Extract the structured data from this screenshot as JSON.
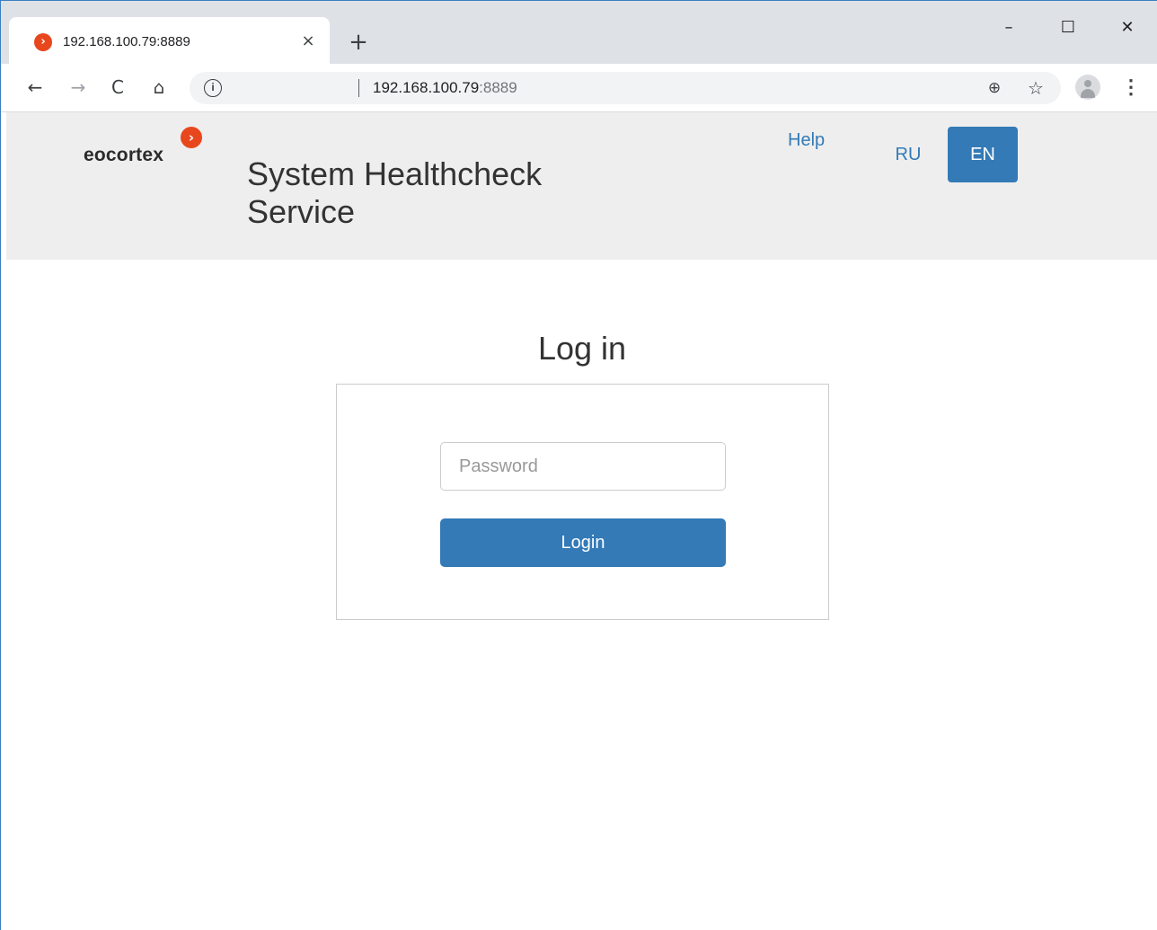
{
  "browser": {
    "tab": {
      "title": "192.168.100.79:8889",
      "favicon": "eocortex-chevron-icon"
    },
    "url": {
      "host": "192.168.100.79",
      "port": ":8889"
    },
    "icons": {
      "close": "×",
      "new_tab": "+",
      "minimize": "–",
      "maximize": "☐",
      "window_close": "✕",
      "back": "←",
      "forward": "→",
      "reload": "C",
      "home": "⌂",
      "info": "i",
      "zoom": "⊕",
      "star": "☆",
      "menu": "⋮"
    }
  },
  "header": {
    "logo_text": "eocortex",
    "logo_badge": "›",
    "title": "System Healthcheck Service",
    "help_label": "Help",
    "languages": {
      "ru": "RU",
      "en": "EN",
      "active": "EN"
    }
  },
  "login": {
    "heading": "Log in",
    "password_placeholder": "Password",
    "button_label": "Login"
  },
  "colors": {
    "brand_orange": "#e8471d",
    "primary_blue": "#337ab7",
    "header_bg": "#eeeeee"
  }
}
